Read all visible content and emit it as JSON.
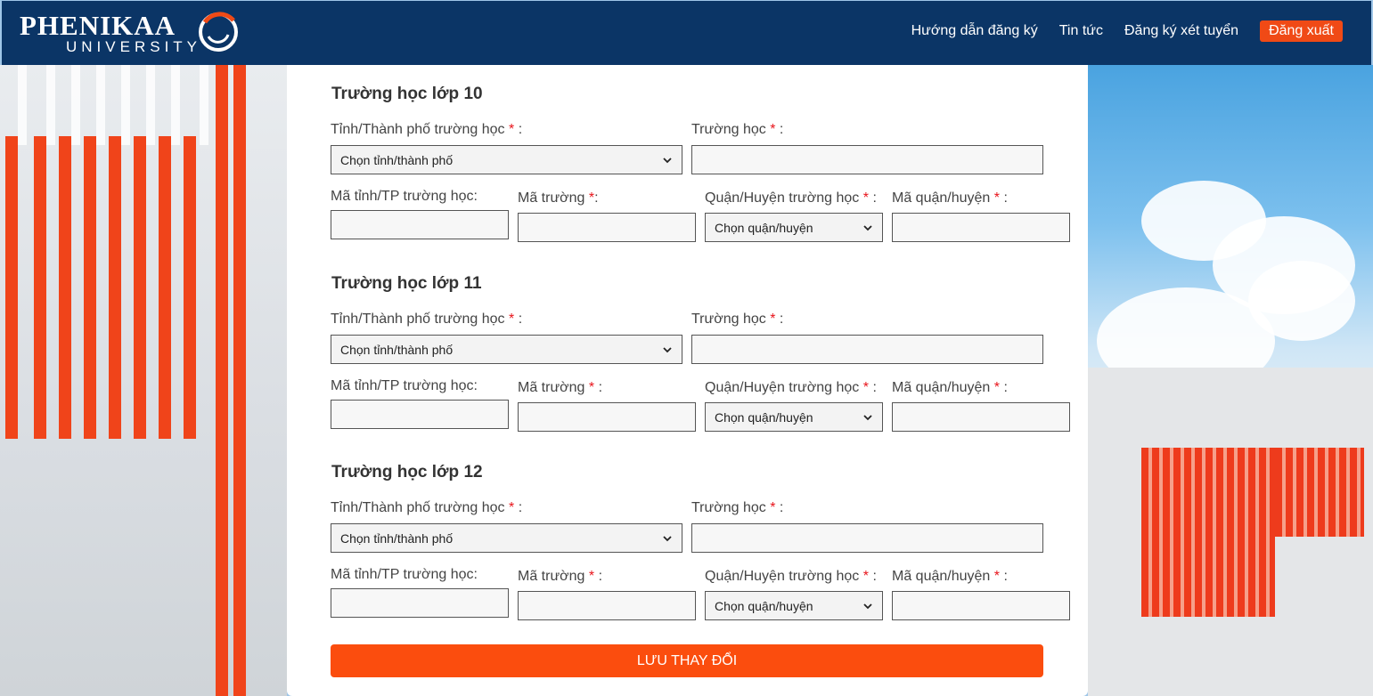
{
  "header": {
    "logo": {
      "name": "PHENIKAA",
      "sub": "UNIVERSITY"
    },
    "nav": [
      {
        "label": "Hướng dẫn đăng ký"
      },
      {
        "label": "Tin tức"
      },
      {
        "label": "Đăng ký xét tuyển"
      }
    ],
    "logout_label": "Đăng xuất"
  },
  "sections": [
    {
      "title": "Trường học lớp 10",
      "province_label": "Tỉnh/Thành phố trường học",
      "province_value": "Chọn tỉnh/thành phố",
      "school_label": "Trường học",
      "school_value": "",
      "province_code_label": "Mã tỉnh/TP trường học:",
      "province_code_value": "",
      "school_code_label": "Mã trường",
      "school_code_value": "",
      "district_label": "Quận/Huyện trường học",
      "district_value": "Chọn quận/huyện",
      "district_code_label": "Mã quận/huyện",
      "district_code_value": ""
    },
    {
      "title": "Trường học lớp 11",
      "province_label": "Tỉnh/Thành phố trường học",
      "province_value": "Chọn tỉnh/thành phố",
      "school_label": "Trường học",
      "school_value": "",
      "province_code_label": "Mã tỉnh/TP trường học:",
      "province_code_value": "",
      "school_code_label": "Mã trường",
      "school_code_value": "",
      "district_label": "Quận/Huyện trường học",
      "district_value": "Chọn quận/huyện",
      "district_code_label": "Mã quận/huyện",
      "district_code_value": ""
    },
    {
      "title": "Trường học lớp 12",
      "province_label": "Tỉnh/Thành phố trường học",
      "province_value": "Chọn tỉnh/thành phố",
      "school_label": "Trường học",
      "school_value": "",
      "province_code_label": "Mã tỉnh/TP trường học:",
      "province_code_value": "",
      "school_code_label": "Mã trường",
      "school_code_value": "",
      "district_label": "Quận/Huyện trường học",
      "district_value": "Chọn quận/huyện",
      "district_code_label": "Mã quận/huyện",
      "district_code_value": ""
    }
  ],
  "required_marker": "*",
  "colon": ":",
  "save_label": "LƯU THAY ĐỔI",
  "colors": {
    "header": "#0b3566",
    "accent": "#fb4d0e",
    "required": "#e8141b"
  }
}
